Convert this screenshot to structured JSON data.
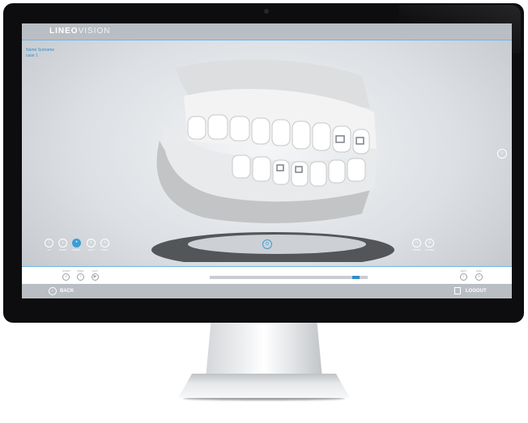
{
  "app": {
    "logo_part1": "LINEO",
    "logo_part2": "VISION",
    "patient_name": "Name Surname",
    "patient_case": "case 1"
  },
  "view_controls": [
    {
      "label": "UP",
      "icon": "arrow-up-icon"
    },
    {
      "label": "DOWN",
      "icon": "arrow-down-icon"
    },
    {
      "label": "FRONT",
      "icon": "front-view-icon",
      "active": true
    },
    {
      "label": "LEFT",
      "icon": "left-view-icon"
    },
    {
      "label": "RIGHT",
      "icon": "right-view-icon"
    }
  ],
  "jaw_controls": [
    {
      "label": "UPPER",
      "icon": "upper-jaw-icon"
    },
    {
      "label": "LOWER",
      "icon": "lower-jaw-icon"
    }
  ],
  "playback": {
    "left_controls": [
      {
        "label": "START",
        "icon": "skip-start-icon"
      },
      {
        "label": "PREV",
        "icon": "previous-icon"
      },
      {
        "label": "PLAY",
        "icon": "play-icon"
      }
    ],
    "right_controls": [
      {
        "label": "NEXT",
        "icon": "next-icon"
      },
      {
        "label": "END",
        "icon": "skip-end-icon"
      }
    ],
    "progress": 0.95
  },
  "bottom": {
    "back_label": "BACK",
    "logout_label": "LOGOUT"
  },
  "colors": {
    "accent": "#2f8fc9",
    "bar": "#b9bec4",
    "bezel": "#0d0d0f"
  }
}
